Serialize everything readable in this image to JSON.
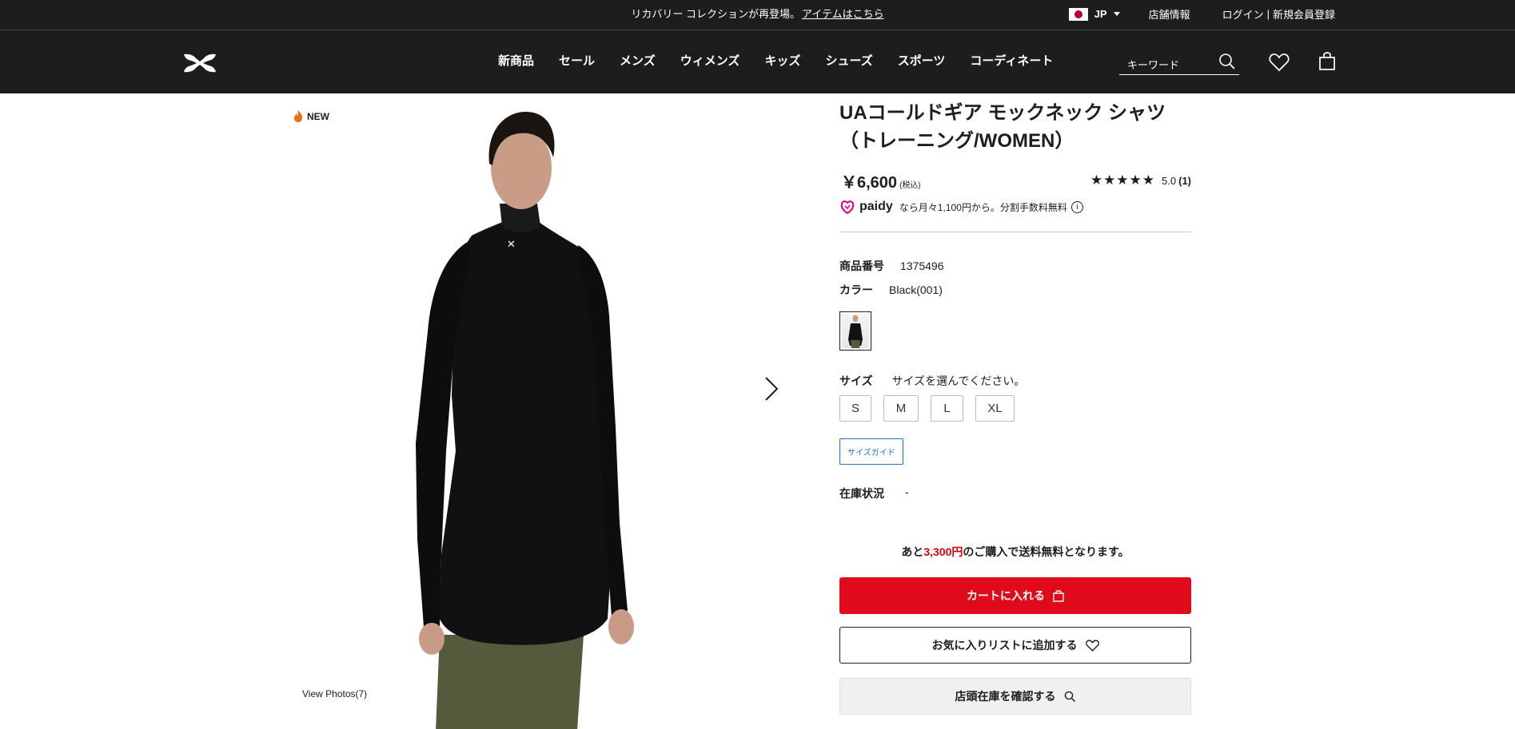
{
  "topbar": {
    "announcement": "リカバリー コレクションが再登場。",
    "announcement_link": "アイテムはこちら",
    "lang": "JP",
    "store_info": "店舗情報",
    "login": "ログイン",
    "register": "新規会員登録"
  },
  "nav": {
    "items": [
      "新商品",
      "セール",
      "メンズ",
      "ウィメンズ",
      "キッズ",
      "シューズ",
      "スポーツ",
      "コーディネート"
    ],
    "search_placeholder": "キーワード"
  },
  "gallery": {
    "badge": "NEW",
    "view_photos": "View Photos(7)"
  },
  "product": {
    "title_line1": "UAコールドギア モックネック シャツ",
    "title_line2": "（トレーニング/WOMEN）",
    "price": "￥6,600",
    "price_tax": "(税込)",
    "rating_stars": "★★★★★",
    "rating_value": "5.0",
    "rating_count": "(1)",
    "paidy_brand": "paidy",
    "paidy_text": "なら月々1,100円から。分割手数料無料",
    "item_number_label": "商品番号",
    "item_number": "1375496",
    "color_label": "カラー",
    "color_value": "Black(001)",
    "size_label": "サイズ",
    "size_prompt": "サイズを選んでください。",
    "sizes": [
      "S",
      "M",
      "L",
      "XL"
    ],
    "size_guide": "サイズガイド",
    "stock_label": "在庫状況",
    "stock_value": "-",
    "shipping_prefix": "あと",
    "shipping_amount": "3,300円",
    "shipping_suffix": "のご購入で送料無料となります。",
    "add_to_cart": "カートに入れる",
    "add_to_wishlist": "お気に入りリストに追加する",
    "check_store_stock": "店頭在庫を確認する"
  },
  "colors": {
    "brand_dark": "#1d1d1d",
    "cart_red": "#e00a1a",
    "accent_blue": "#1a73c8",
    "shipping_red": "#d3000e"
  }
}
